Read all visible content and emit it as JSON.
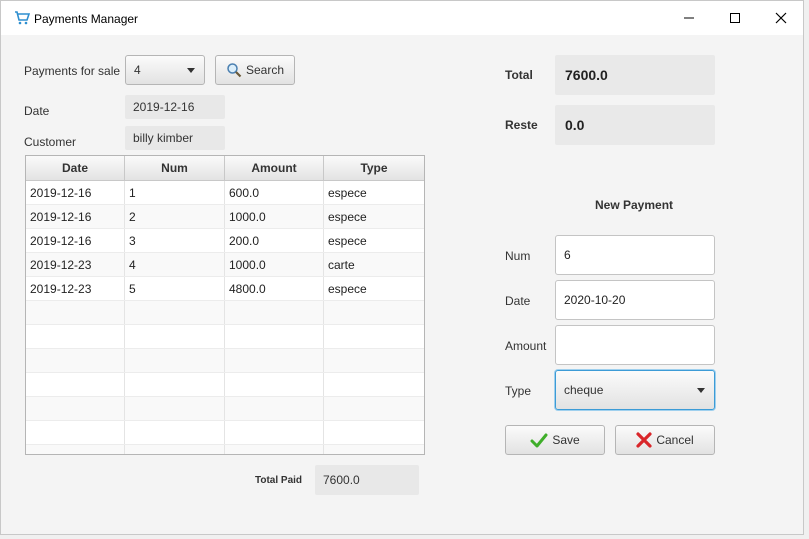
{
  "window": {
    "title": "Payments Manager"
  },
  "filter": {
    "label": "Payments for sale",
    "sale_value": "4",
    "search_label": "Search"
  },
  "info": {
    "date_label": "Date",
    "date_value": "2019-12-16",
    "customer_label": "Customer",
    "customer_value": "billy kimber"
  },
  "table": {
    "columns": [
      "Date",
      "Num",
      "Amount",
      "Type"
    ],
    "rows": [
      [
        "2019-12-16",
        "1",
        "600.0",
        "espece"
      ],
      [
        "2019-12-16",
        "2",
        "1000.0",
        "espece"
      ],
      [
        "2019-12-16",
        "3",
        "200.0",
        "espece"
      ],
      [
        "2019-12-23",
        "4",
        "1000.0",
        "carte"
      ],
      [
        "2019-12-23",
        "5",
        "4800.0",
        "espece"
      ]
    ],
    "empty_rows": 7
  },
  "total_paid": {
    "label": "Total Paid",
    "value": "7600.0"
  },
  "summary": {
    "total_label": "Total",
    "total_value": "7600.0",
    "reste_label": "Reste",
    "reste_value": "0.0"
  },
  "new_payment": {
    "heading": "New Payment",
    "num_label": "Num",
    "num_value": "6",
    "date_label": "Date",
    "date_value": "2020-10-20",
    "amount_label": "Amount",
    "amount_value": "",
    "type_label": "Type",
    "type_value": "cheque",
    "save_label": "Save",
    "cancel_label": "Cancel"
  },
  "colors": {
    "focus": "#3c9bd6",
    "save_icon": "#3fae2a",
    "cancel_icon": "#d9262a",
    "cart_icon": "#2f8fd0"
  }
}
